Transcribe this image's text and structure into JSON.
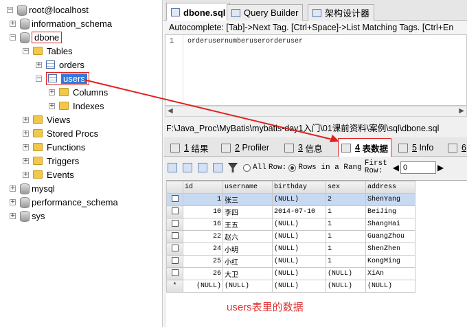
{
  "tree": {
    "root": "root@localhost",
    "items": [
      {
        "label": "information_schema"
      },
      {
        "label": "dbone"
      },
      {
        "label": "Tables"
      },
      {
        "label": "orders"
      },
      {
        "label": "users"
      },
      {
        "label": "Columns"
      },
      {
        "label": "Indexes"
      },
      {
        "label": "Views"
      },
      {
        "label": "Stored Procs"
      },
      {
        "label": "Functions"
      },
      {
        "label": "Triggers"
      },
      {
        "label": "Events"
      },
      {
        "label": "mysql"
      },
      {
        "label": "performance_schema"
      },
      {
        "label": "sys"
      }
    ]
  },
  "tabs": {
    "t1": "dbone.sql",
    "t2": "Query Builder",
    "t3": "架构设计器"
  },
  "autocomplete": "Autocomplete: [Tab]->Next Tag. [Ctrl+Space]->List Matching Tags. [Ctrl+En",
  "editor": {
    "line": "1",
    "code": "orderusernumberuserorderuser"
  },
  "path": "F:\\Java_Proc\\MyBatis\\mybatis-day1入门\\01课前资料\\案例\\sql\\dbone.sql",
  "result_tabs": {
    "r1n": "1",
    "r1": "结果",
    "r2n": "2",
    "r2": "Profiler",
    "r3n": "3",
    "r3": "信息",
    "r4n": "4",
    "r4": "表数据",
    "r5n": "5",
    "r5": "Info",
    "r6n": "6"
  },
  "toolbar": {
    "all": "All",
    "row": "Row:",
    "rows_in_range": "Rows in a Rang",
    "first_row_1": "First",
    "first_row_2": "Row:",
    "first_row_value": "0"
  },
  "table": {
    "headers": [
      "id",
      "username",
      "birthday",
      "sex",
      "address"
    ],
    "rows": [
      {
        "id": "1",
        "username": "张三",
        "birthday": "(NULL)",
        "sex": "2",
        "address": "ShenYang"
      },
      {
        "id": "10",
        "username": "李四",
        "birthday": "2014-07-10",
        "sex": "1",
        "address": "BeiJing"
      },
      {
        "id": "16",
        "username": "王五",
        "birthday": "(NULL)",
        "sex": "1",
        "address": "ShangHai"
      },
      {
        "id": "22",
        "username": "赵六",
        "birthday": "(NULL)",
        "sex": "1",
        "address": "GuangZhou"
      },
      {
        "id": "24",
        "username": "小明",
        "birthday": "(NULL)",
        "sex": "1",
        "address": "ShenZhen"
      },
      {
        "id": "25",
        "username": "小红",
        "birthday": "(NULL)",
        "sex": "1",
        "address": "KongMing"
      },
      {
        "id": "26",
        "username": "大卫",
        "birthday": "(NULL)",
        "sex": "(NULL)",
        "address": "XiAn"
      }
    ],
    "new_row": {
      "marker": "*",
      "id": "(NULL)",
      "username": "(NULL)",
      "birthday": "(NULL)",
      "sex": "(NULL)",
      "address": "(NULL)"
    }
  },
  "annotation": "users表里的数据",
  "colors": {
    "annotation": "#e03030",
    "selection": "#3478d8"
  }
}
